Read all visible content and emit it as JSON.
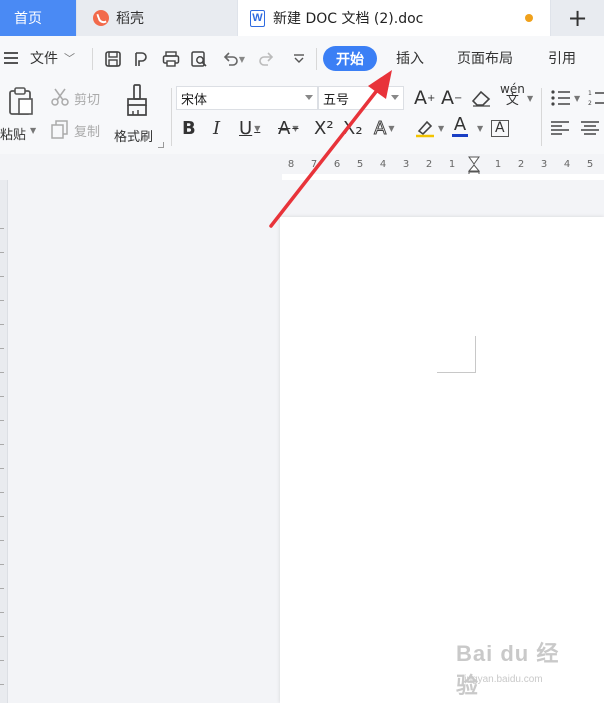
{
  "tabs": {
    "home": "首页",
    "daoke": "稻壳",
    "doc_title": "新建 DOC 文档 (2).doc",
    "add_symbol": "+"
  },
  "menu": {
    "file": "文件",
    "ribbon_tabs": [
      "开始",
      "插入",
      "页面布局",
      "引用"
    ]
  },
  "ribbon": {
    "paste": "粘贴",
    "cut": "剪切",
    "copy": "复制",
    "format_painter": "格式刷",
    "font_name": "宋体",
    "font_size": "五号",
    "bold": "B",
    "italic": "I",
    "underline": "U",
    "strike": "A",
    "superscript": "X²",
    "subscript": "X₂",
    "text_effect": "A",
    "highlight": "A",
    "font_color": "A",
    "char_border": "A",
    "grow": "A",
    "shrink": "A",
    "phonetic": "wén"
  },
  "ruler": {
    "numbers": [
      "8",
      "7",
      "6",
      "5",
      "4",
      "3",
      "2",
      "1",
      "",
      "1",
      "2",
      "3",
      "4",
      "5"
    ]
  },
  "colors": {
    "accent": "#3b7ff5",
    "home_tab": "#4a8af4",
    "arrow": "#e8333a",
    "font_color_bar": "#1a3fc4",
    "unsaved_dot": "#f0a11b"
  },
  "watermark": {
    "main": "Bai du 经验",
    "sub": "jingyan.baidu.com"
  }
}
